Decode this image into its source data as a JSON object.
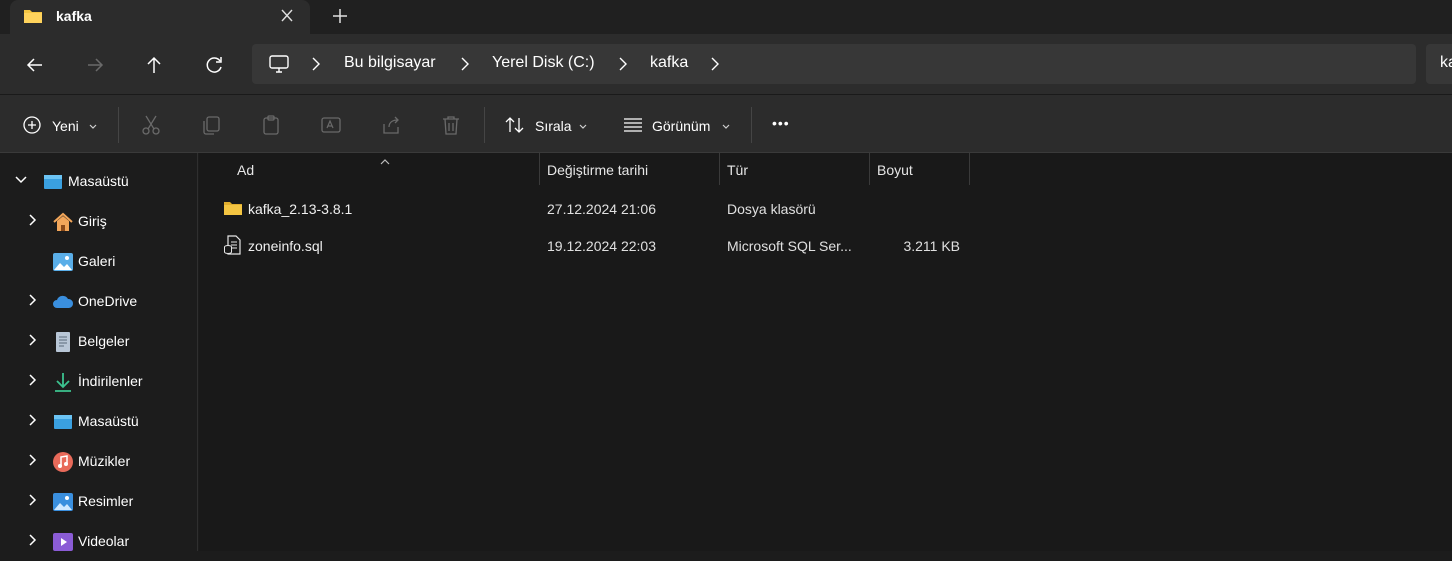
{
  "tabs": {
    "active_title": "kafka",
    "close_label": "✕",
    "new_tab_label": "+"
  },
  "address_bar": {
    "crumbs": [
      "Bu bilgisayar",
      "Yerel Disk (C:)",
      "kafka"
    ],
    "search_text": "ka"
  },
  "toolbar": {
    "new_label": "Yeni",
    "sort_label": "Sırala",
    "view_label": "Görünüm",
    "more_label": "•••"
  },
  "sidebar": {
    "items": [
      {
        "label": "Masaüstü",
        "icon": "desktop-icon",
        "expanded": true
      },
      {
        "label": "Giriş",
        "icon": "home-icon"
      },
      {
        "label": "Galeri",
        "icon": "gallery-icon"
      },
      {
        "label": "OneDrive",
        "icon": "onedrive-icon"
      },
      {
        "label": "Belgeler",
        "icon": "documents-icon"
      },
      {
        "label": "İndirilenler",
        "icon": "downloads-icon"
      },
      {
        "label": "Masaüstü",
        "icon": "desktop-icon"
      },
      {
        "label": "Müzikler",
        "icon": "music-icon"
      },
      {
        "label": "Resimler",
        "icon": "pictures-icon"
      },
      {
        "label": "Videolar",
        "icon": "videos-icon"
      }
    ]
  },
  "file_list": {
    "columns": [
      "Ad",
      "Değiştirme tarihi",
      "Tür",
      "Boyut"
    ],
    "rows": [
      {
        "name": "kafka_2.13-3.8.1",
        "modified": "27.12.2024 21:06",
        "type": "Dosya klasörü",
        "size": "",
        "icon": "folder-icon"
      },
      {
        "name": "zoneinfo.sql",
        "modified": "19.12.2024 22:03",
        "type": "Microsoft SQL Ser...",
        "size": "3.211 KB",
        "icon": "sql-file-icon"
      }
    ]
  },
  "colors": {
    "folder": "#f4c542",
    "onedrive": "#3a8fde",
    "downloads": "#3cc28f",
    "music": "#e86a5a",
    "videos": "#8b5cd6"
  }
}
